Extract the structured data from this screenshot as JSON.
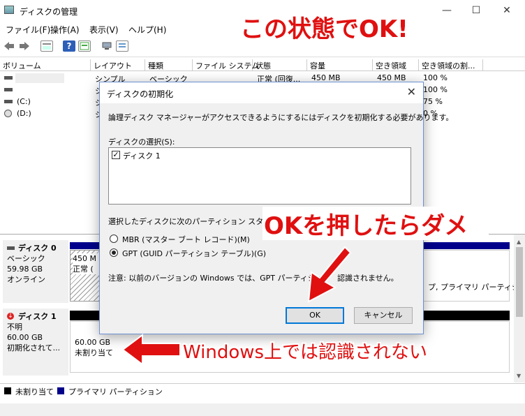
{
  "window": {
    "title": "ディスクの管理",
    "minimize": "—",
    "maximize": "☐",
    "close": "✕"
  },
  "menu": [
    "ファイル(F)",
    "操作(A)",
    "表示(V)",
    "ヘルプ(H)"
  ],
  "columns": [
    "ボリューム",
    "レイアウト",
    "種類",
    "ファイル システム",
    "状態",
    "容量",
    "空き領域",
    "空き領域の割..."
  ],
  "volumes": [
    {
      "name": "",
      "layout": "シンプル",
      "type": "ベーシック",
      "fs": "",
      "status": "正常 (回復...",
      "capacity": "450 MB",
      "free": "450 MB",
      "pct": "100 %"
    },
    {
      "name": "",
      "layout": "シ",
      "type": "",
      "fs": "",
      "status": "",
      "capacity": "",
      "free": "",
      "pct": "100 %"
    },
    {
      "name": "(C:)",
      "layout": "シ",
      "type": "",
      "fs": "",
      "status": "",
      "capacity": "",
      "free": "",
      "pct": "75 %"
    },
    {
      "name": "(D:)",
      "layout": "シ",
      "type": "",
      "fs": "",
      "status": "",
      "capacity": "",
      "free": "",
      "pct": "0 %"
    }
  ],
  "disks": [
    {
      "name": "ディスク 0",
      "type": "ベーシック",
      "size": "59.98 GB",
      "status": "オンライン",
      "part_size": "450 M",
      "part_status": "正常 (",
      "tail_text": "プ, プライマリ パーティショ"
    },
    {
      "name": "ディスク 1",
      "type": "不明",
      "size": "60.00 GB",
      "status": "初期化されて...",
      "part_size": "60.00 GB",
      "part_status": "未割り当て"
    }
  ],
  "legend": [
    {
      "label": "未割り当て",
      "color": "#000000"
    },
    {
      "label": "プライマリ パーティション",
      "color": "#00008b"
    }
  ],
  "dialog": {
    "title": "ディスクの初期化",
    "message": "論理ディスク マネージャーがアクセスできるようにするにはディスクを初期化する必要があります。",
    "select_label": "ディスクの選択(S):",
    "disk_item": "ディスク 1",
    "style_label": "選択したディスクに次のパーティション スタイルを使",
    "style_label_tail": "(",
    "mbr_label": "MBR (マスター ブート レコード)(M)",
    "gpt_label": "GPT (GUID パーティション テーブル)(G)",
    "note": "注意: 以前のバージョンの Windows では、GPT パーティション",
    "note_tail": "認識されません。",
    "ok": "OK",
    "cancel": "キャンセル"
  },
  "annotations": {
    "top": "この状態でOK!",
    "middle": "OKを押したらダメ",
    "bottom": "Windows上では認識されない"
  },
  "colors": {
    "annotation_red": "#e01010",
    "partition_bar": "#00008b",
    "unallocated_bar": "#000000",
    "accent": "#0078d7"
  }
}
